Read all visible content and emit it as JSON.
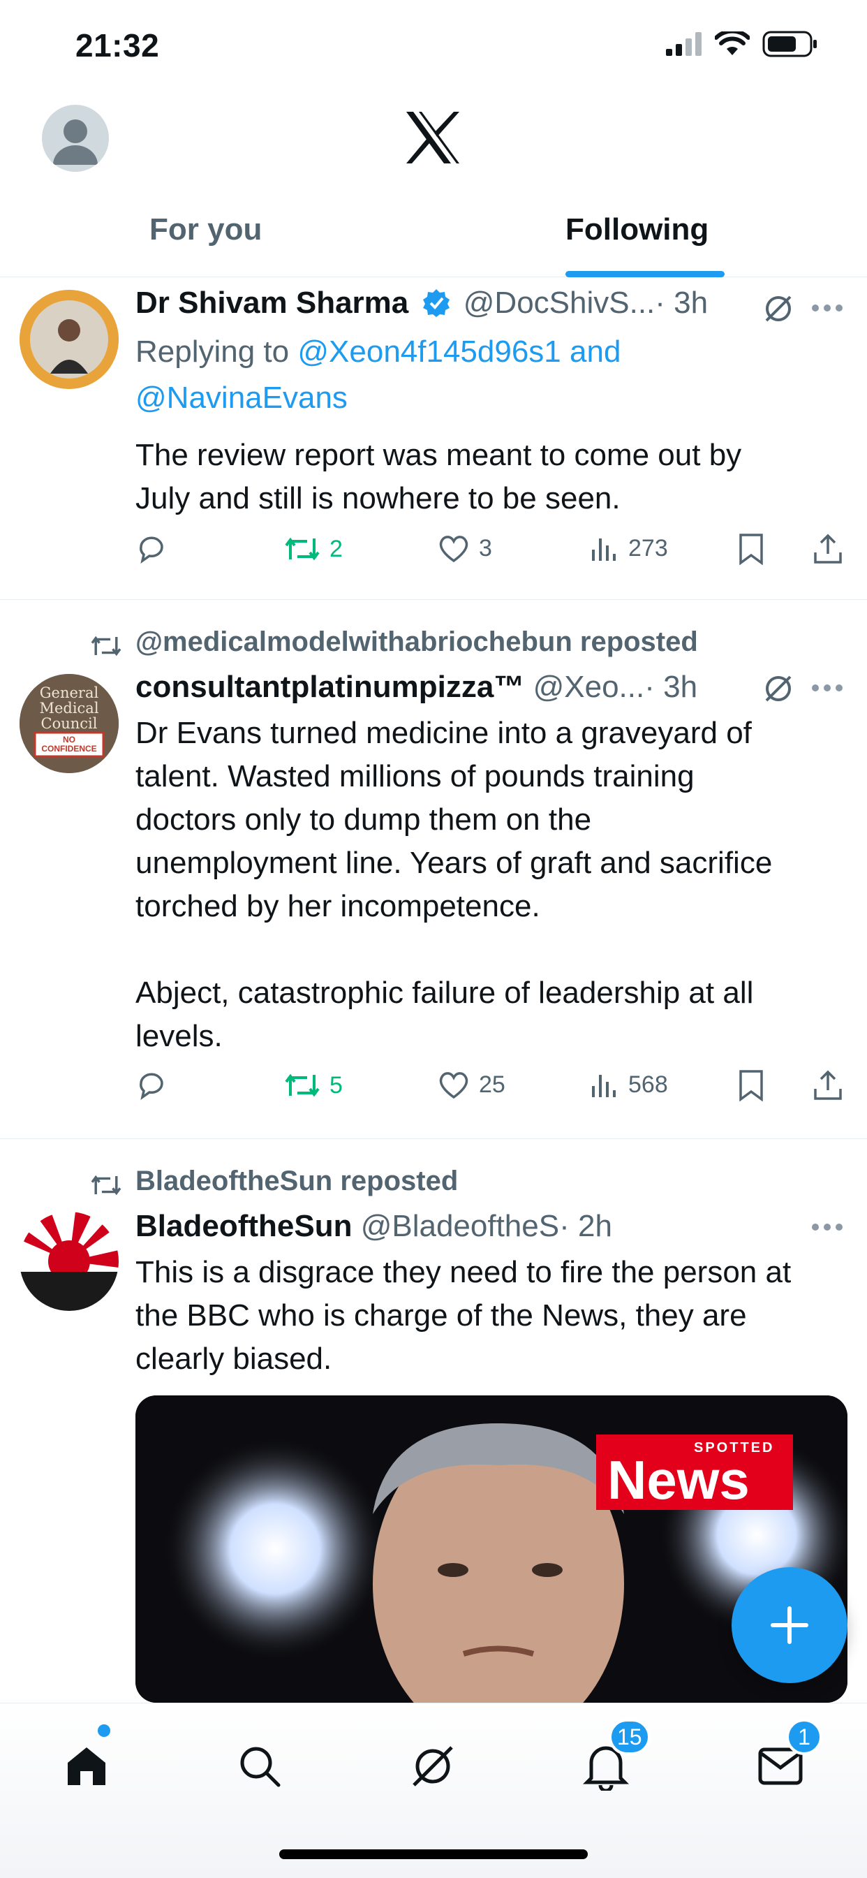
{
  "status_bar": {
    "time": "21:32"
  },
  "tabs": [
    {
      "label": "For you"
    },
    {
      "label": "Following"
    }
  ],
  "posts": [
    {
      "name": "Dr Shivam Sharma",
      "handle": "@DocShivS...",
      "time": "· 3h",
      "replying_prefix": "Replying to ",
      "replying_to": "@Xeon4f145d96s1 and",
      "replying_to2": "@NavinaEvans",
      "text": "The review report was meant to come out by\nJuly and still is nowhere to be seen.",
      "retweets": "2",
      "likes": "3",
      "views": "273"
    },
    {
      "repost_by": "@medicalmodelwithabriochebun reposted",
      "name": "consultantplatinumpizza™",
      "handle": "@Xeo...",
      "time": "· 3h",
      "avatar_text": "General Medical Council",
      "avatar_stamp": "NO CONFIDENCE",
      "text": "Dr Evans turned medicine into a graveyard of\ntalent. Wasted millions of pounds training\ndoctors only to dump them on the\nunemployment line. Years of graft and sacrifice\ntorched by her incompetence.\n\nAbject, catastrophic failure of leadership at all\nlevels.",
      "retweets": "5",
      "likes": "25",
      "views": "568"
    },
    {
      "repost_by": "BladeoftheSun reposted",
      "name": "BladeoftheSun",
      "handle": "@BladeoftheS",
      "time": "· 2h",
      "text": "This is a disgrace they need to fire the person at\nthe BBC who is charge of the News, they are\nclearly biased.",
      "image_badge_small": "SPOTTED",
      "image_badge": "News"
    }
  ],
  "nav": {
    "notifications_badge": "15",
    "messages_badge": "1"
  },
  "colors": {
    "accent": "#1d9bf0",
    "retweet_green": "#00ba7c",
    "secondary_text": "#536471"
  }
}
